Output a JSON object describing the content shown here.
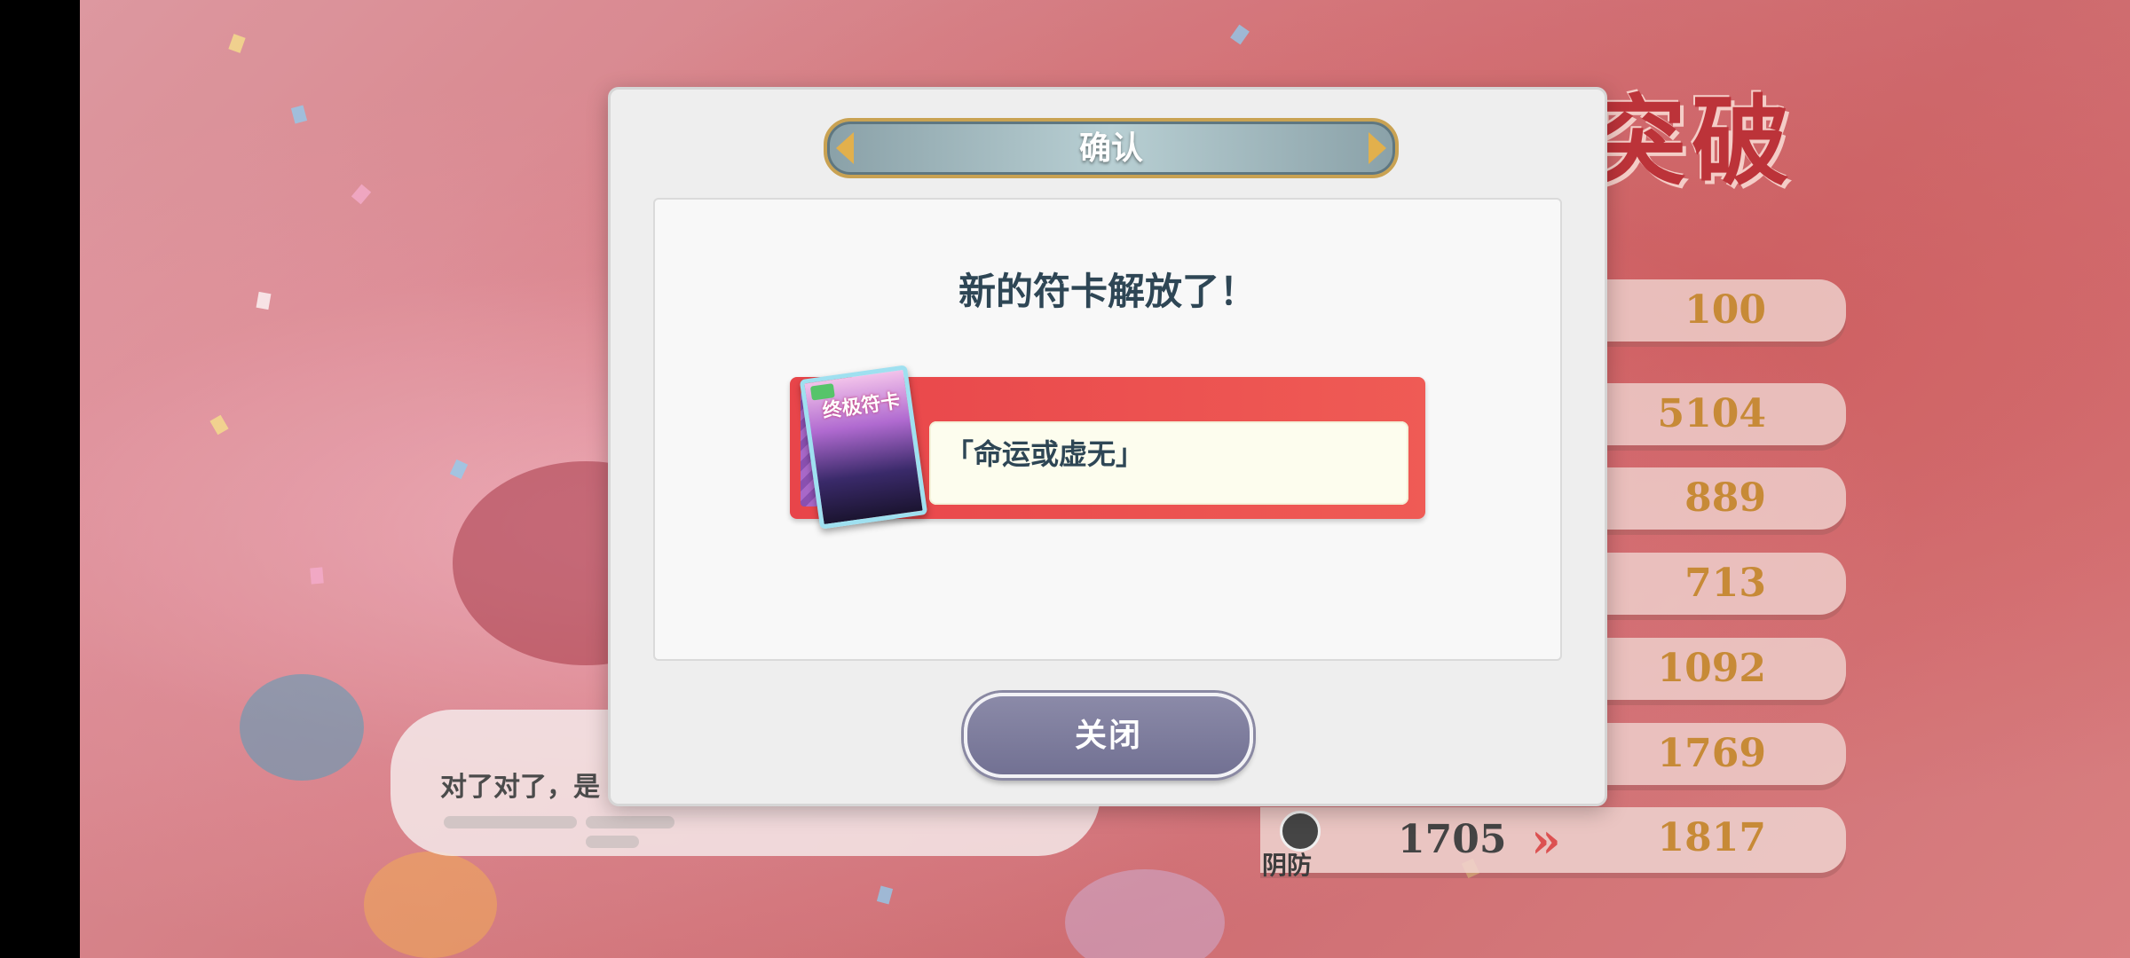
{
  "background": {
    "title": "突破",
    "stats": [
      {
        "new": "100"
      },
      {
        "new": "5104"
      },
      {
        "new": "889"
      },
      {
        "new": "713"
      },
      {
        "new": "1092"
      },
      {
        "new": "1769"
      }
    ],
    "defense": {
      "label": "阴防",
      "old": "1705",
      "arrow": "»",
      "new": "1817"
    },
    "dialog_text": "对了对了，是"
  },
  "modal": {
    "title": "确认",
    "message": "新的符卡解放了！",
    "spellcard": {
      "image_title": "终极符卡",
      "name": "「命运或虚无」"
    },
    "close_label": "关闭"
  },
  "colors": {
    "accent_red": "#e8454a",
    "header_gold": "#c9a252",
    "button_purple": "#7f7ea0",
    "text_dark": "#2e4655",
    "stat_gold": "#c07a1c"
  }
}
